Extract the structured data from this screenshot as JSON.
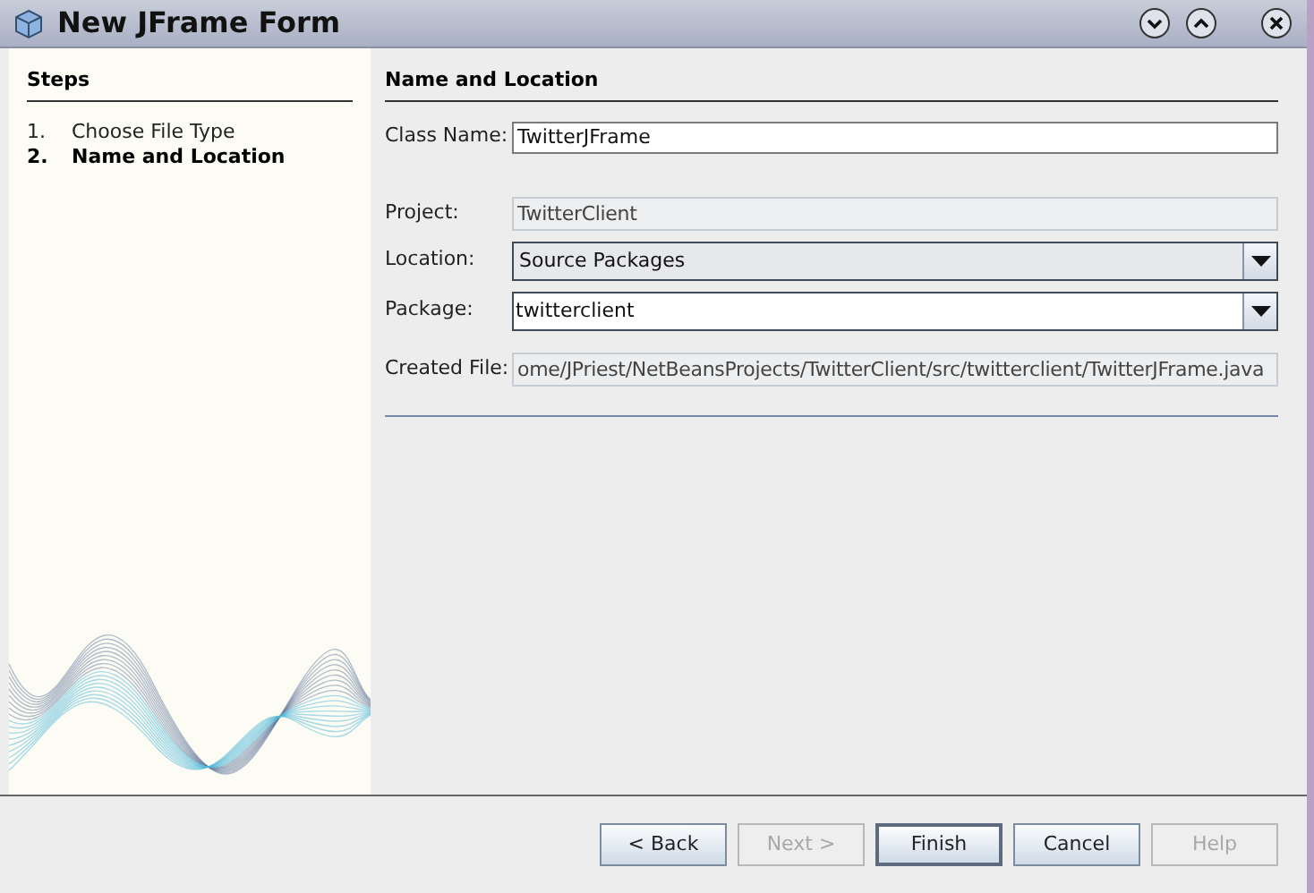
{
  "window": {
    "title": "New JFrame Form"
  },
  "steps": {
    "heading": "Steps",
    "items": [
      {
        "number": "1.",
        "label": "Choose File Type",
        "selected": false
      },
      {
        "number": "2.",
        "label": "Name and Location",
        "selected": true
      }
    ]
  },
  "panel": {
    "heading": "Name and Location",
    "fields": [
      {
        "kind": "text",
        "label": "Class Name:",
        "value": "TwitterJFrame"
      },
      {
        "kind": "readonly",
        "label": "Project:",
        "value": "TwitterClient"
      },
      {
        "kind": "combo",
        "label": "Location:",
        "value": "Source Packages",
        "editable": false
      },
      {
        "kind": "combo",
        "label": "Package:",
        "value": "twitterclient",
        "editable": true
      },
      {
        "kind": "readonly",
        "label": "Created File:",
        "value": "ome/JPriest/NetBeansProjects/TwitterClient/src/twitterclient/TwitterJFrame.java"
      }
    ]
  },
  "buttons": [
    {
      "label": "< Back",
      "disabled": false,
      "default": false
    },
    {
      "label": "Next >",
      "disabled": true,
      "default": false
    },
    {
      "label": "Finish",
      "disabled": false,
      "default": true
    },
    {
      "label": "Cancel",
      "disabled": false,
      "default": false
    },
    {
      "label": "Help",
      "disabled": true,
      "default": false
    }
  ]
}
